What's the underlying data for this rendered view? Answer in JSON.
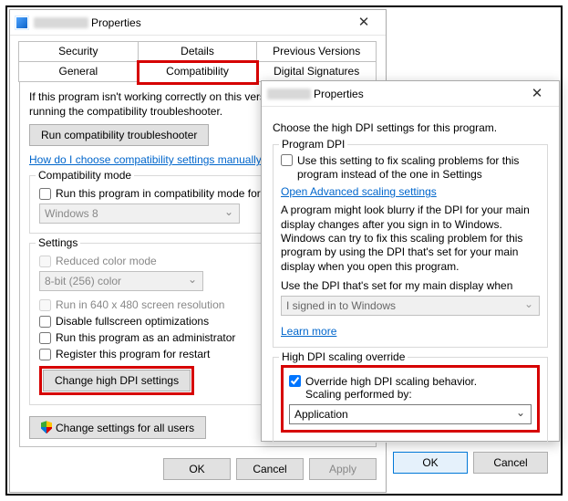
{
  "dlg1": {
    "title_suffix": "Properties",
    "tabs_upper": [
      "Security",
      "Details",
      "Previous Versions"
    ],
    "tabs_lower": [
      "General",
      "Compatibility",
      "Digital Signatures"
    ],
    "active_tab": "Compatibility",
    "desc": "If this program isn't working correctly on this version of Windows, try running the compatibility troubleshooter.",
    "run_trouble": "Run compatibility troubleshooter",
    "manual_link": "How do I choose compatibility settings manually?",
    "compat_mode": {
      "title": "Compatibility mode",
      "check_label": "Run this program in compatibility mode for:",
      "select_value": "Windows 8"
    },
    "settings": {
      "title": "Settings",
      "reduced_color": "Reduced color mode",
      "color_value": "8-bit (256) color",
      "run_640": "Run in 640 x 480 screen resolution",
      "disable_fs": "Disable fullscreen optimizations",
      "run_admin": "Run this program as an administrator",
      "register_restart": "Register this program for restart",
      "change_dpi": "Change high DPI settings"
    },
    "change_all": "Change settings for all users",
    "buttons": {
      "ok": "OK",
      "cancel": "Cancel",
      "apply": "Apply"
    }
  },
  "dlg2": {
    "title_suffix": "Properties",
    "intro": "Choose the high DPI settings for this program.",
    "program_dpi": {
      "title": "Program DPI",
      "check_label": "Use this setting to fix scaling problems for this program instead of the one in Settings",
      "adv_link": "Open Advanced scaling settings",
      "para": "A program might look blurry if the DPI for your main display changes after you sign in to Windows. Windows can try to fix this scaling problem for this program by using the DPI that's set for your main display when you open this program.",
      "use_dpi_label": "Use the DPI that's set for my main display when",
      "use_dpi_value": "I signed in to Windows",
      "learn_more": "Learn more"
    },
    "override": {
      "title": "High DPI scaling override",
      "check1": "Override high DPI scaling behavior.",
      "check2": "Scaling performed by:",
      "select_value": "Application"
    },
    "buttons": {
      "ok": "OK",
      "cancel": "Cancel"
    }
  }
}
